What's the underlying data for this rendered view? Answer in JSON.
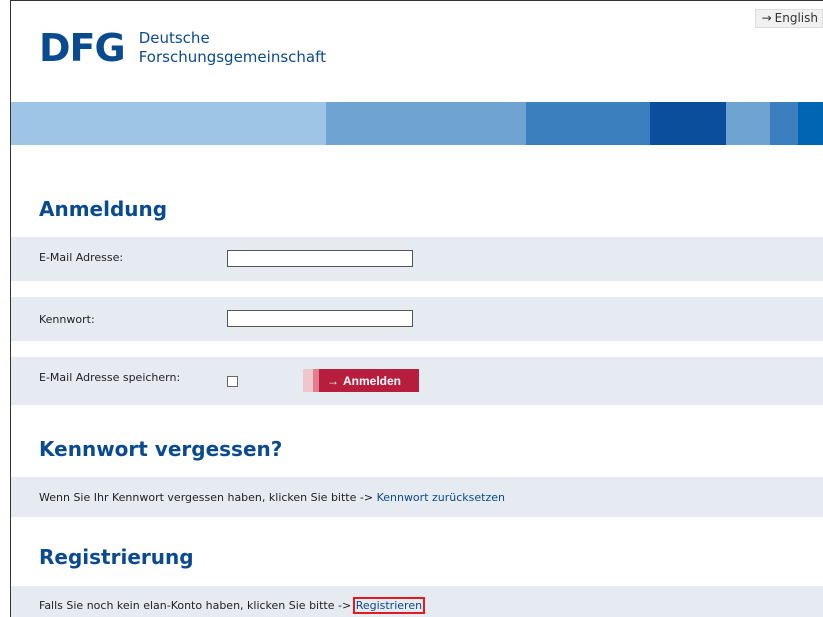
{
  "header": {
    "lang_arrow": "→",
    "lang_label": "English",
    "logo_mark": "DFG",
    "logo_line1": "Deutsche",
    "logo_line2": "Forschungsgemeinschaft"
  },
  "stripe_colors": [
    "#9ec4e6",
    "#6ea3d2",
    "#3c7fbf",
    "#0b4f9c",
    "#6ea3d2",
    "#3c7fbf",
    "#0066b3"
  ],
  "login": {
    "title": "Anmeldung",
    "email_label": "E-Mail Adresse:",
    "email_value": "",
    "password_label": "Kennwort:",
    "password_value": "",
    "remember_label": "E-Mail Adresse speichern:",
    "submit_arrow": "→",
    "submit_label": "Anmelden"
  },
  "forgot": {
    "title": "Kennwort vergessen?",
    "text": "Wenn Sie Ihr Kennwort vergessen haben, klicken Sie bitte -> ",
    "link": "Kennwort zurücksetzen"
  },
  "register": {
    "title": "Registrierung",
    "text": "Falls Sie noch kein elan-Konto haben, klicken Sie bitte -> ",
    "link": "Registrieren"
  }
}
